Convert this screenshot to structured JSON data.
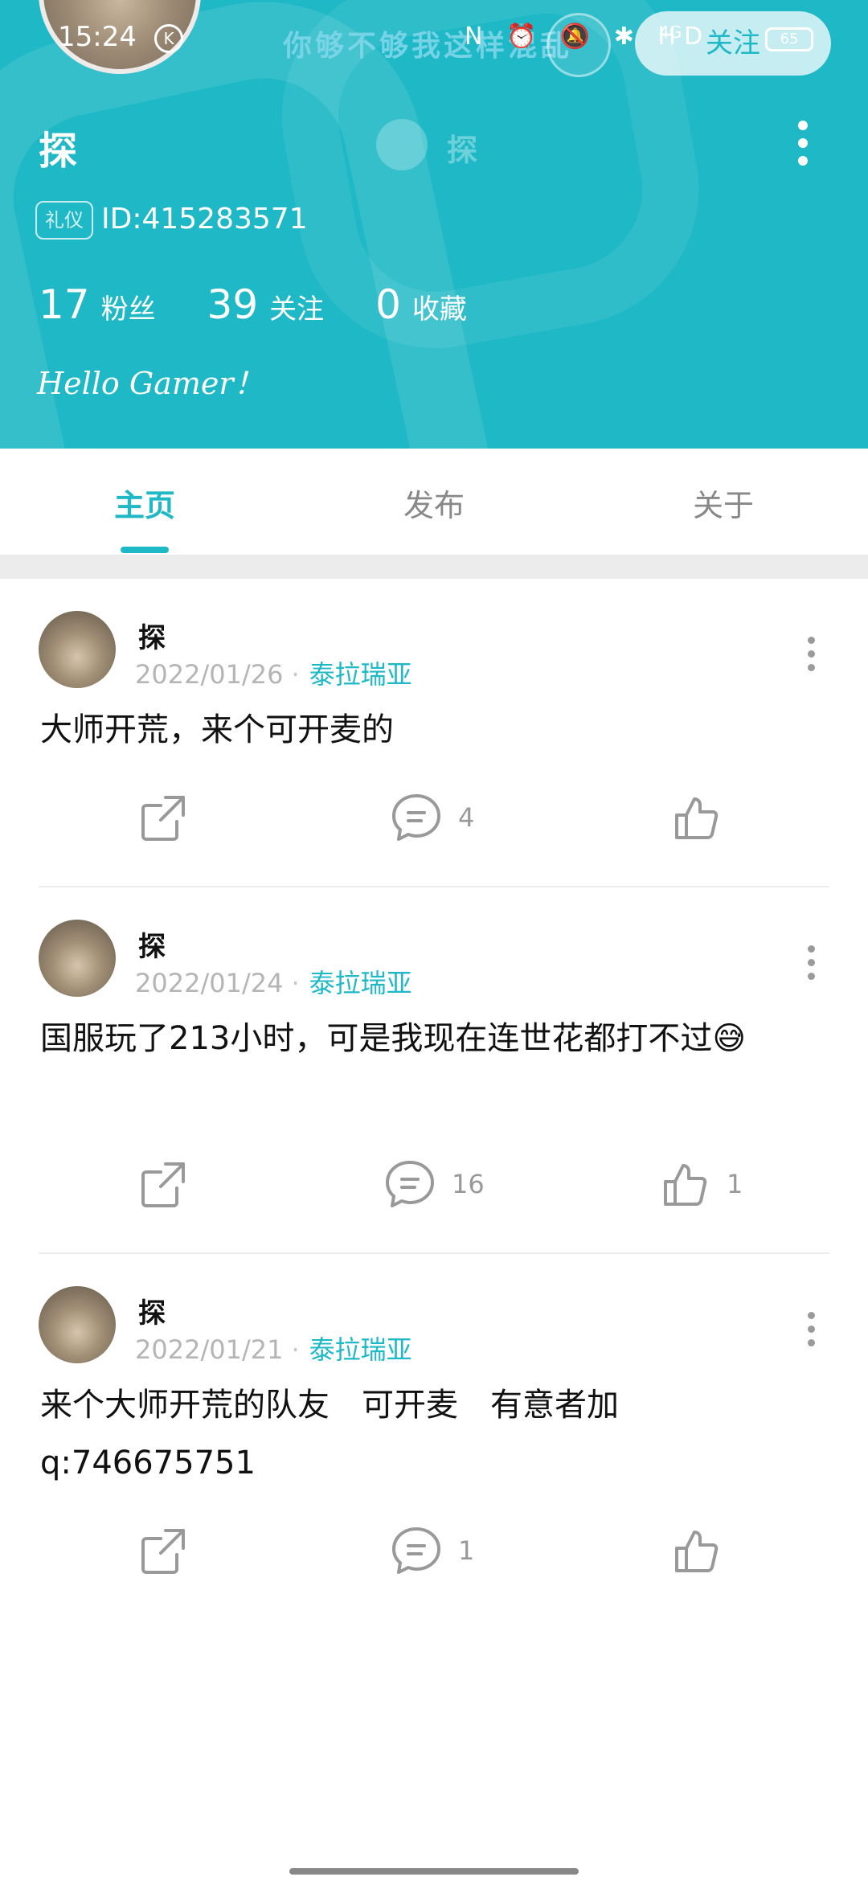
{
  "status_bar": {
    "time": "15:24",
    "k_icon": "K",
    "floating_message": "你够不够我这样混乱",
    "system_icons": "N ⏰ 🔕 ✱ HD",
    "signal": "4G",
    "battery": "65"
  },
  "header": {
    "username": "探",
    "mini_username": "探",
    "badge": "礼仪",
    "user_id": "ID:415283571",
    "stats": [
      {
        "num": "17",
        "label": "粉丝"
      },
      {
        "num": "39",
        "label": "关注"
      },
      {
        "num": "0",
        "label": "收藏"
      }
    ],
    "bio": "Hello Gamer！",
    "follow_label": "关注",
    "background_color": "#1fb8c6"
  },
  "tabs": [
    {
      "label": "主页",
      "active": true
    },
    {
      "label": "发布",
      "active": false
    },
    {
      "label": "关于",
      "active": false
    }
  ],
  "posts": [
    {
      "author": "探",
      "date": "2022/01/26",
      "game": "泰拉瑞亚",
      "text": "大师开荒，来个可开麦的",
      "comments": "4",
      "likes": ""
    },
    {
      "author": "探",
      "date": "2022/01/24",
      "game": "泰拉瑞亚",
      "text": "国服玩了213小时，可是我现在连世花都打不过😅",
      "comments": "16",
      "likes": "1"
    },
    {
      "author": "探",
      "date": "2022/01/21",
      "game": "泰拉瑞亚",
      "text": "来个大师开荒的队友　可开麦　有意者加q:746675751",
      "comments": "1",
      "likes": ""
    }
  ],
  "accent_color": "#1fb8c6"
}
